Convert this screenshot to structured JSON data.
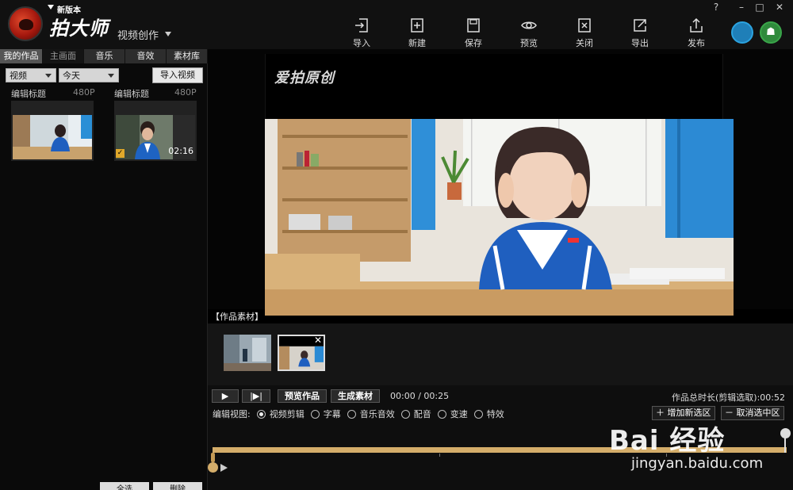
{
  "app": {
    "badge": "新版本",
    "name": "拍大师",
    "mode": "视频创作"
  },
  "toolbar": [
    {
      "id": "import",
      "label": "导入"
    },
    {
      "id": "new",
      "label": "新建"
    },
    {
      "id": "save",
      "label": "保存"
    },
    {
      "id": "preview",
      "label": "预览"
    },
    {
      "id": "close",
      "label": "关闭"
    },
    {
      "id": "export",
      "label": "导出"
    },
    {
      "id": "publish",
      "label": "发布"
    }
  ],
  "window": {
    "help": "?",
    "minimize": "–",
    "maximize": "□",
    "close": "✕"
  },
  "left": {
    "tabs": [
      "我的作品",
      "主画面",
      "音乐",
      "音效",
      "素材库"
    ],
    "filter_type": "视频",
    "filter_date": "今天",
    "import_button": "导入视频",
    "clips": [
      {
        "title": "编辑标题",
        "resolution": "480P",
        "duration": "",
        "selected": false
      },
      {
        "title": "编辑标题",
        "resolution": "480P",
        "duration": "02:16",
        "selected": true
      }
    ],
    "footer": {
      "select_all": "全选",
      "delete": "删除"
    }
  },
  "preview": {
    "watermark": "爱拍原创",
    "materials_label": "【作品素材】"
  },
  "controls": {
    "play": "▶",
    "step": "|▶|",
    "preview_work": "预览作品",
    "generate": "生成素材",
    "time": "00:00 / 00:25",
    "total": "作品总时长(剪辑选取):00:52",
    "edit_view_label": "编辑视图:",
    "views": [
      {
        "label": "视频剪辑",
        "checked": true
      },
      {
        "label": "字幕",
        "checked": false
      },
      {
        "label": "音乐音效",
        "checked": false
      },
      {
        "label": "配音",
        "checked": false
      },
      {
        "label": "变速",
        "checked": false
      },
      {
        "label": "特效",
        "checked": false
      }
    ],
    "add_selection": "＋ 增加新选区",
    "cancel_selection": "－ 取消选中区"
  },
  "overlay": {
    "brand": "Bai 经验",
    "url": "jingyan.baidu.com"
  },
  "colors": {
    "accent_timeline": "#d4ad6a",
    "ios": "#2ba3e0",
    "android": "#3aa64a"
  }
}
